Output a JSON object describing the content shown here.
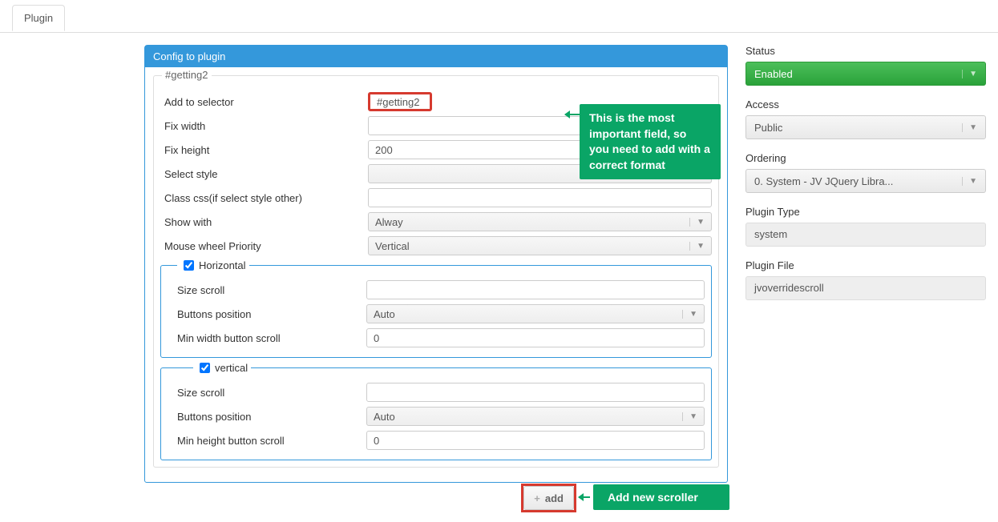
{
  "tab": "Plugin",
  "panel": {
    "title": "Config to plugin",
    "inner_title": "#getting2",
    "fields": {
      "selector_label": "Add to selector",
      "selector_value": "#getting2",
      "fix_width_label": "Fix width",
      "fix_width_value": "",
      "fix_height_label": "Fix height",
      "fix_height_value": "200",
      "select_style_label": "Select style",
      "select_style_value": "",
      "class_css_label": "Class css(if select style other)",
      "class_css_value": "",
      "show_with_label": "Show with",
      "show_with_value": "Alway",
      "mouse_wheel_label": "Mouse wheel Priority",
      "mouse_wheel_value": "Vertical"
    },
    "horiz": {
      "legend": "Horizontal",
      "checked": true,
      "size_label": "Size scroll",
      "size_value": "",
      "btnpos_label": "Buttons position",
      "btnpos_value": "Auto",
      "minw_label": "Min width button scroll",
      "minw_value": "0"
    },
    "vert": {
      "legend": "vertical",
      "checked": true,
      "size_label": "Size scroll",
      "size_value": "",
      "btnpos_label": "Buttons position",
      "btnpos_value": "Auto",
      "minh_label": "Min height button scroll",
      "minh_value": "0"
    },
    "add_label": "add"
  },
  "callouts": {
    "top_line1": "This is the most important field, so",
    "top_line2": "you need to add with a correct format",
    "add": "Add new scroller"
  },
  "side": {
    "status_label": "Status",
    "status_value": "Enabled",
    "access_label": "Access",
    "access_value": "Public",
    "ordering_label": "Ordering",
    "ordering_value": "0. System - JV JQuery Libra...",
    "type_label": "Plugin Type",
    "type_value": "system",
    "file_label": "Plugin File",
    "file_value": "jvoverridescroll"
  }
}
